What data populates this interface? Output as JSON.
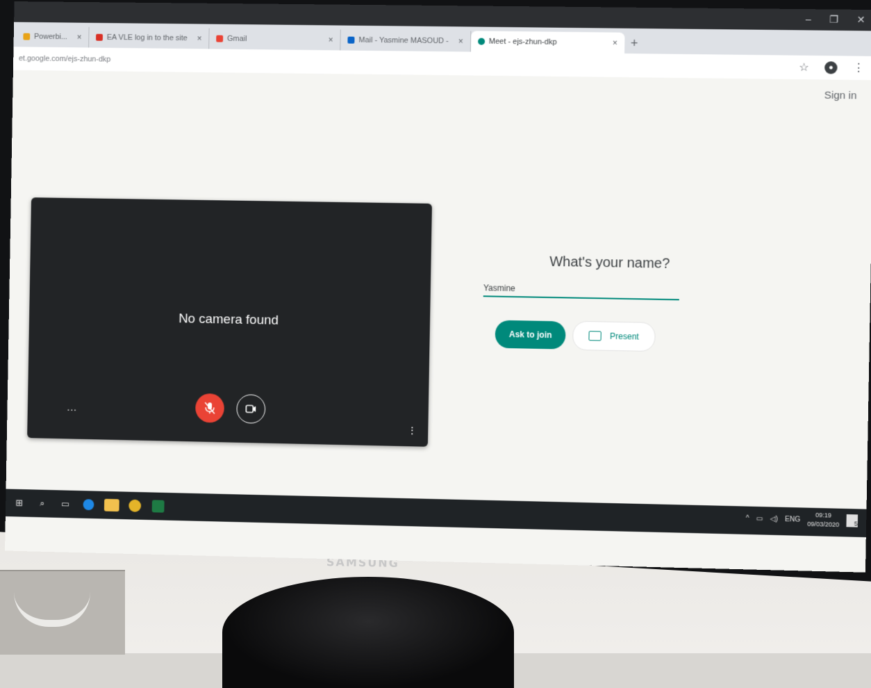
{
  "browser": {
    "tabs": [
      {
        "label": "Powerbi...",
        "favicon_color": "#e8a317",
        "active": false
      },
      {
        "label": "EA VLE log in to the site",
        "favicon_color": "#d93025",
        "active": false
      },
      {
        "label": "Gmail",
        "favicon_color": "#ea4335",
        "active": false
      },
      {
        "label": "Mail - Yasmine MASOUD -",
        "favicon_color": "#0a64c8",
        "active": false
      },
      {
        "label": "Meet - ejs-zhun-dkp",
        "favicon_color": "#00897b",
        "active": true
      }
    ],
    "new_tab_label": "+",
    "url": "et.google.com/ejs-zhun-dkp",
    "bookmark_icon": "☆",
    "profile_icon": "●",
    "menu_icon": "⋮"
  },
  "page": {
    "signin_label": "Sign in",
    "preview": {
      "message": "No camera found",
      "more_left": "...",
      "more_right": "⋮"
    },
    "join": {
      "title": "What's your name?",
      "name_value": "Yasmine",
      "ask_to_join_label": "Ask to join",
      "present_label": "Present"
    }
  },
  "taskbar": {
    "tray_text": "ENG",
    "time": "09:19",
    "date": "09/03/2020",
    "notification_count": "5"
  },
  "monitor": {
    "brand": "SAMSUNG"
  },
  "colors": {
    "accent": "#00897b",
    "mic_off": "#ea4335",
    "preview_bg": "#222426"
  }
}
